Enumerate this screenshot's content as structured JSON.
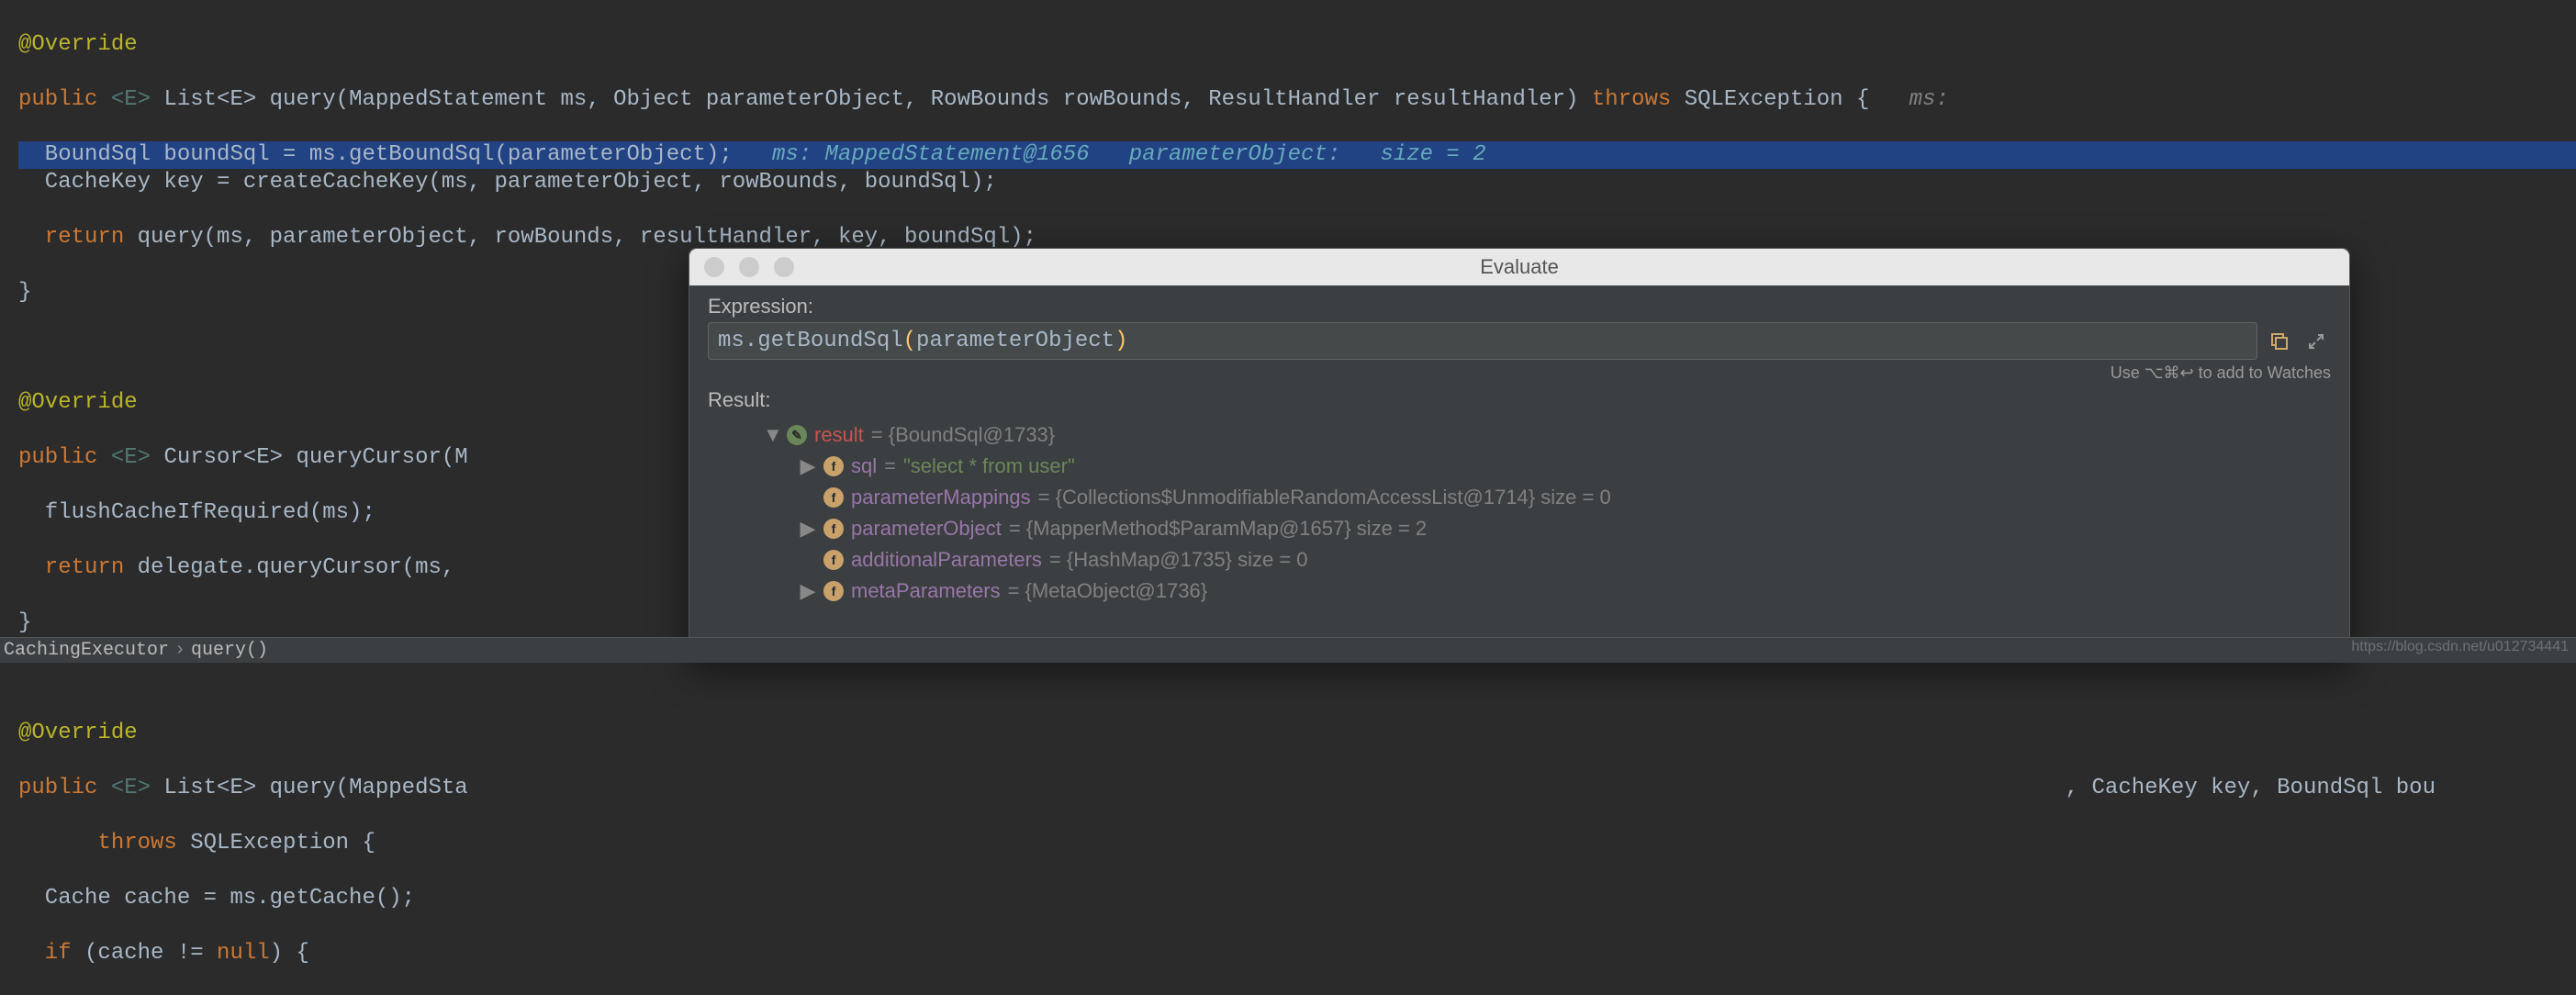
{
  "code": {
    "line1": "@Override",
    "line2_kw1": "public",
    "line2_gen": " <E> ",
    "line2_type": "List<E> query(MappedStatement ms, Object parameterObject, RowBounds rowBounds, ResultHandler resultHandler)",
    "line2_kw2": " throws ",
    "line2_exc": "SQLException {",
    "line2_inlay": "   ms:",
    "line3_a": "  BoundSql boundSql = ms.getBoundSql(parameterObject);",
    "line3_inlay1": "   ms: MappedStatement@1656   parameterObject:   size = 2",
    "line4": "  CacheKey key = createCacheKey(ms, parameterObject, rowBounds, boundSql);",
    "line5_kw": "  return ",
    "line5_body": "query(ms, parameterObject, rowBounds, resultHandler, key, boundSql);",
    "line6": "}",
    "line8": "@Override",
    "line9_kw1": "public",
    "line9_gen": " <E> ",
    "line9_type": "Cursor<E> queryCursor(M",
    "line10": "  flushCacheIfRequired(ms);",
    "line11_kw": "  return ",
    "line11_body": "delegate.queryCursor(ms,",
    "line12": "}",
    "line14": "@Override",
    "line15_kw1": "public",
    "line15_gen": " <E> ",
    "line15_type": "List<E> query(MappedSta",
    "line15_tail": ", CacheKey key, BoundSql bou",
    "line16_kw": "      throws ",
    "line16_body": "SQLException {",
    "line17": "  Cache cache = ms.getCache();",
    "line18_kw": "  if ",
    "line18_body": "(cache != ",
    "line18_null": "null",
    "line18_end": ") {"
  },
  "breadcrumb": {
    "item1": "CachingExecutor",
    "item2": "query()"
  },
  "evaluate": {
    "title": "Evaluate",
    "expression_label": "Expression:",
    "expression_value_a": "ms.getBoundSql",
    "expression_value_b": "(",
    "expression_value_c": "parameterObject",
    "expression_value_d": ")",
    "hint": "Use ⌥⌘↩ to add to Watches",
    "result_label": "Result:",
    "tree": {
      "root_name": "result",
      "root_val": " = {BoundSql@1733}",
      "sql_name": "sql",
      "sql_eq": " = ",
      "sql_val": "\"select * from user\"",
      "pm_name": "parameterMappings",
      "pm_val": " = {Collections$UnmodifiableRandomAccessList@1714}  size = 0",
      "po_name": "parameterObject",
      "po_val": " = {MapperMethod$ParamMap@1657}  size = 2",
      "ap_name": "additionalParameters",
      "ap_val": " = {HashMap@1735}  size = 0",
      "mp_name": "metaParameters",
      "mp_val": " = {MetaObject@1736}"
    }
  },
  "watermark": "https://blog.csdn.net/u012734441"
}
